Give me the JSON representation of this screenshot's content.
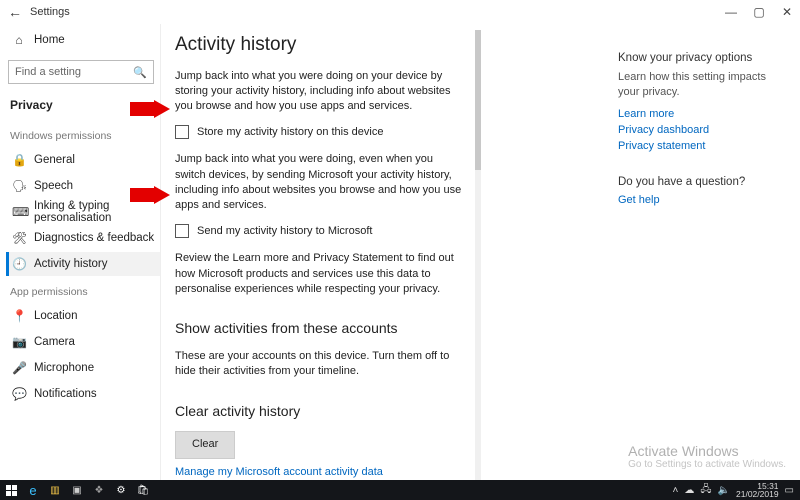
{
  "titlebar": {
    "back_glyph": "←",
    "title": "Settings",
    "min": "—",
    "max": "▢",
    "close": "✕"
  },
  "sidebar": {
    "home": "Home",
    "search_placeholder": "Find a setting",
    "category": "Privacy",
    "section_win": "Windows permissions",
    "items_win": [
      {
        "icon": "🔒",
        "label": "General"
      },
      {
        "icon": "🗣",
        "label": "Speech"
      },
      {
        "icon": "⌨",
        "label": "Inking & typing personalisation"
      },
      {
        "icon": "🛠",
        "label": "Diagnostics & feedback"
      },
      {
        "icon": "🕘",
        "label": "Activity history"
      }
    ],
    "section_app": "App permissions",
    "items_app": [
      {
        "icon": "📍",
        "label": "Location"
      },
      {
        "icon": "📷",
        "label": "Camera"
      },
      {
        "icon": "🎤",
        "label": "Microphone"
      },
      {
        "icon": "💬",
        "label": "Notifications"
      }
    ]
  },
  "main": {
    "h1": "Activity history",
    "p1": "Jump back into what you were doing on your device by storing your activity history, including info about websites you browse and how you use apps and services.",
    "chk1": "Store my activity history on this device",
    "p2": "Jump back into what you were doing, even when you switch devices, by sending Microsoft your activity history, including info about websites you browse and how you use apps and services.",
    "chk2": "Send my activity history to Microsoft",
    "p3": "Review the Learn more and Privacy Statement to find out how Microsoft products and services use this data to personalise experiences while respecting your privacy.",
    "h2a": "Show activities from these accounts",
    "p4": "These are your accounts on this device. Turn them off to hide their activities from your timeline.",
    "h2b": "Clear activity history",
    "clear": "Clear",
    "manage": "Manage my Microsoft account activity data"
  },
  "aside": {
    "t1": "Know your privacy options",
    "d1": "Learn how this setting impacts your privacy.",
    "l1": "Learn more",
    "l2": "Privacy dashboard",
    "l3": "Privacy statement",
    "t2": "Do you have a question?",
    "l4": "Get help"
  },
  "watermark": {
    "l1": "Activate Windows",
    "l2": "Go to Settings to activate Windows."
  },
  "taskbar": {
    "time": "15:31",
    "date": "21/02/2019"
  }
}
